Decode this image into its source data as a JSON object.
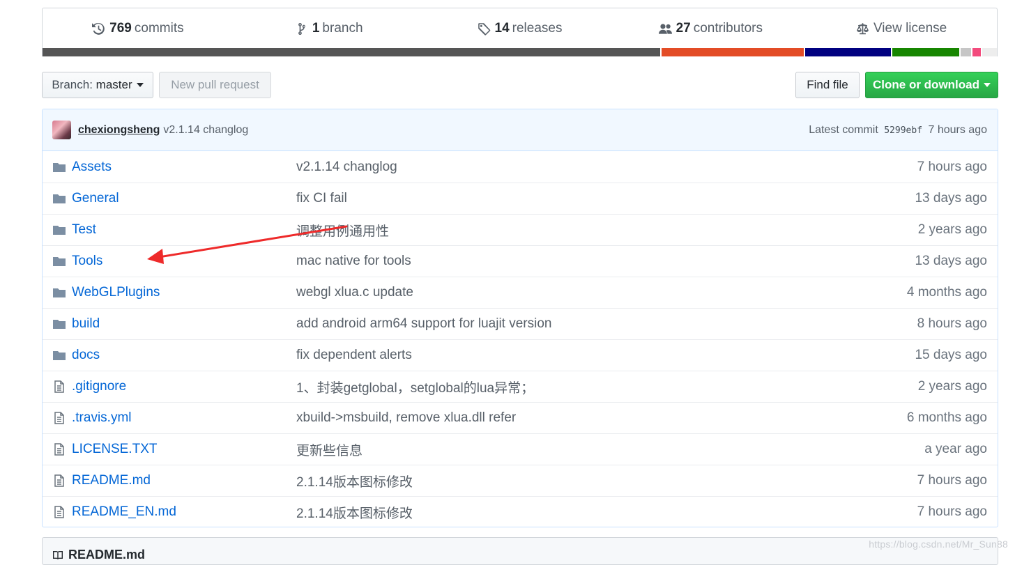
{
  "stats": {
    "commits": {
      "count": "769",
      "label": "commits"
    },
    "branches": {
      "count": "1",
      "label": "branch"
    },
    "releases": {
      "count": "14",
      "label": "releases"
    },
    "contributors": {
      "count": "27",
      "label": "contributors"
    },
    "license": {
      "label": "View license"
    }
  },
  "language_bar_colors": [
    "#555555",
    "#e34c26",
    "#000080",
    "#178600",
    "#c6c6c6",
    "#f34b7d",
    "#ededed"
  ],
  "toolbar": {
    "branch_label": "Branch:",
    "branch_value": "master",
    "new_pr_label": "New pull request",
    "find_file_label": "Find file",
    "clone_label": "Clone or download"
  },
  "latest_commit": {
    "author": "chexiongsheng",
    "message": "v2.1.14 changlog",
    "prefix": "Latest commit",
    "sha": "5299ebf",
    "age": "7 hours ago"
  },
  "files": [
    {
      "type": "folder",
      "name": "Assets",
      "message": "v2.1.14 changlog",
      "age": "7 hours ago"
    },
    {
      "type": "folder",
      "name": "General",
      "message": "fix CI fail",
      "age": "13 days ago"
    },
    {
      "type": "folder",
      "name": "Test",
      "message": "调整用例通用性",
      "age": "2 years ago"
    },
    {
      "type": "folder",
      "name": "Tools",
      "message": "mac native for tools",
      "age": "13 days ago"
    },
    {
      "type": "folder",
      "name": "WebGLPlugins",
      "message": "webgl xlua.c update",
      "age": "4 months ago"
    },
    {
      "type": "folder",
      "name": "build",
      "message": "add android arm64 support for luajit version",
      "age": "8 hours ago"
    },
    {
      "type": "folder",
      "name": "docs",
      "message": "fix dependent alerts",
      "age": "15 days ago"
    },
    {
      "type": "file",
      "name": ".gitignore",
      "message": "1、封装getglobal，setglobal的lua异常；",
      "age": "2 years ago"
    },
    {
      "type": "file",
      "name": ".travis.yml",
      "message": "xbuild->msbuild, remove xlua.dll refer",
      "age": "6 months ago"
    },
    {
      "type": "file",
      "name": "LICENSE.TXT",
      "message": "更新些信息",
      "age": "a year ago"
    },
    {
      "type": "file",
      "name": "README.md",
      "message": "2.1.14版本图标修改",
      "age": "7 hours ago"
    },
    {
      "type": "file",
      "name": "README_EN.md",
      "message": "2.1.14版本图标修改",
      "age": "7 hours ago"
    }
  ],
  "readme": {
    "title": "README.md"
  },
  "watermark": "https://blog.csdn.net/Mr_Sun88"
}
